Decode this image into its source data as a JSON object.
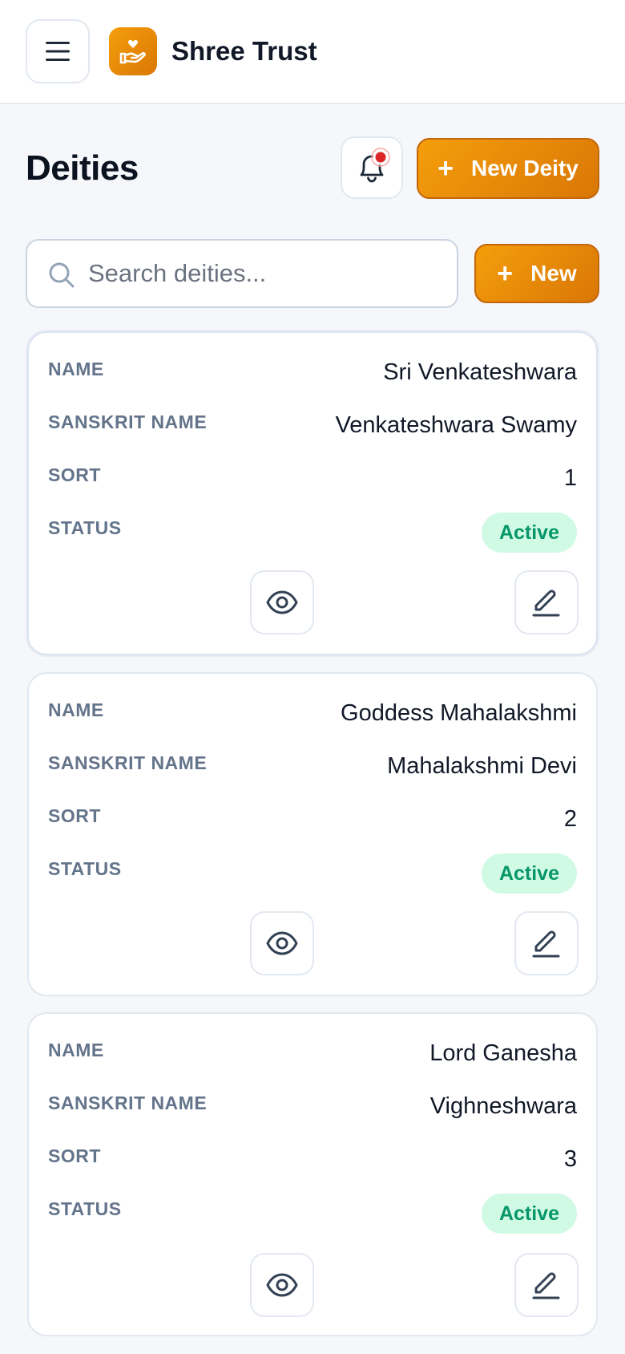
{
  "header": {
    "brand": "Shree Trust",
    "menu_icon": "hamburger-icon",
    "logo_icon": "hand-heart-icon"
  },
  "page": {
    "title": "Deities",
    "new_deity_label": "New Deity",
    "new_label": "New",
    "plus_glyph": "+",
    "notification_icon": "bell-icon"
  },
  "search": {
    "placeholder": "Search deities...",
    "value": ""
  },
  "labels": {
    "name": "NAME",
    "sanskrit_name": "SANSKRIT NAME",
    "sort": "SORT",
    "status": "STATUS"
  },
  "deities": [
    {
      "name": "Sri Venkateshwara",
      "sanskrit_name": "Venkateshwara Swamy",
      "sort": "1",
      "status": "Active"
    },
    {
      "name": "Goddess Mahalakshmi",
      "sanskrit_name": "Mahalakshmi Devi",
      "sort": "2",
      "status": "Active"
    },
    {
      "name": "Lord Ganesha",
      "sanskrit_name": "Vighneshwara",
      "sort": "3",
      "status": "Active"
    }
  ],
  "colors": {
    "accent": "#f59e0b",
    "accent_dark": "#d97706",
    "status_active_bg": "#d1fae5",
    "status_active_text": "#059669",
    "notification_dot": "#dc2626"
  }
}
